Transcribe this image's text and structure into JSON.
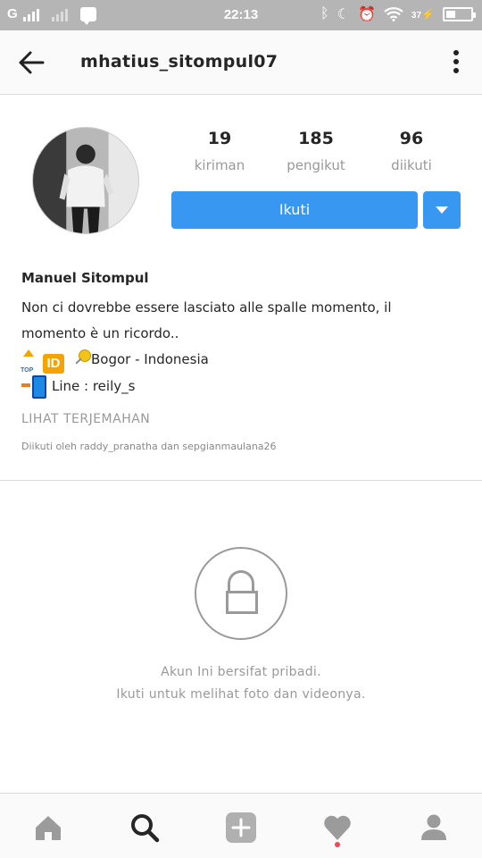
{
  "status_bar": {
    "carrier": "G",
    "time": "22:13",
    "battery_percent": "37",
    "battery_level": 0.37,
    "icons": [
      "signal-icon",
      "message-icon",
      "bluetooth-icon",
      "moon-icon",
      "alarm-icon",
      "wifi-icon",
      "charging-icon",
      "battery-icon"
    ]
  },
  "app_bar": {
    "username": "mhatius_sitompul07",
    "back_icon": "arrow-left-icon",
    "more_icon": "more-vertical-icon"
  },
  "profile": {
    "stats": [
      {
        "value": "19",
        "label": "kiriman"
      },
      {
        "value": "185",
        "label": "pengikut"
      },
      {
        "value": "96",
        "label": "diikuti"
      }
    ],
    "follow_label": "Ikuti"
  },
  "bio": {
    "name": "Manuel Sitompul",
    "text_line1": "Non ci dovrebbe essere lasciato alle spalle momento, il",
    "text_line2": "momento è un ricordo..",
    "location": "Bogor - Indonesia",
    "id_emoji": "ID",
    "line": "Line : reily_s",
    "translate_label": "LIHAT TERJEMAHAN",
    "followed_by": "Diikuti oleh raddy_pranatha dan sepgianmaulana26"
  },
  "private": {
    "line1": "Akun Ini bersifat pribadi.",
    "line2": "Ikuti untuk melihat foto dan videonya."
  },
  "bottom_nav": {
    "items": [
      "home-icon",
      "search-icon",
      "add-icon",
      "heart-icon",
      "profile-icon"
    ],
    "active": "search-icon",
    "notification_color": "#ed4956"
  },
  "colors": {
    "accent": "#3897f0",
    "status_bar": "#b5b5b5",
    "muted_text": "#999999"
  }
}
